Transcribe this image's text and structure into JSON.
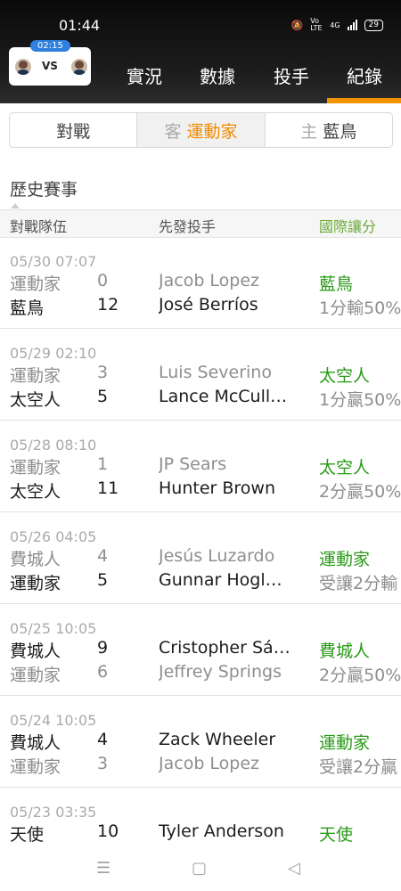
{
  "status": {
    "time": "01:44",
    "battery": "29",
    "network": "4G",
    "volte": "Vo LTE"
  },
  "scorecard": {
    "game_time": "02:15",
    "vs": "VS"
  },
  "nav": {
    "tabs": [
      "實況",
      "數據",
      "投手",
      "紀錄"
    ],
    "active": 3
  },
  "segment": {
    "tabs": [
      {
        "prefix": "",
        "label": "對戰",
        "active": false
      },
      {
        "prefix": "客",
        "label": "運動家",
        "active": true
      },
      {
        "prefix": "主",
        "label": "藍鳥",
        "active": false
      }
    ]
  },
  "section_title": "歷史賽事",
  "columns": {
    "teams": "對戰隊伍",
    "pitchers": "先發投手",
    "handicap": "國際讓分"
  },
  "games": [
    {
      "date": "05/30 07:07",
      "rows": [
        {
          "team": "運動家",
          "score": "0",
          "pitcher": "Jacob Lopez",
          "odds": "藍鳥",
          "win": false
        },
        {
          "team": "藍鳥",
          "score": "12",
          "pitcher": "José Berríos",
          "odds": "1分輸50%",
          "win": true
        }
      ]
    },
    {
      "date": "05/29 02:10",
      "rows": [
        {
          "team": "運動家",
          "score": "3",
          "pitcher": "Luis Severino",
          "odds": "太空人",
          "win": false
        },
        {
          "team": "太空人",
          "score": "5",
          "pitcher": "Lance McCullers Jr.",
          "odds": "1分贏50%",
          "win": true
        }
      ]
    },
    {
      "date": "05/28 08:10",
      "rows": [
        {
          "team": "運動家",
          "score": "1",
          "pitcher": "JP Sears",
          "odds": "太空人",
          "win": false
        },
        {
          "team": "太空人",
          "score": "11",
          "pitcher": "Hunter Brown",
          "odds": "2分贏50%",
          "win": true
        }
      ]
    },
    {
      "date": "05/26 04:05",
      "rows": [
        {
          "team": "費城人",
          "score": "4",
          "pitcher": "Jesús Luzardo",
          "odds": "運動家",
          "win": false
        },
        {
          "team": "運動家",
          "score": "5",
          "pitcher": "Gunnar Hoglund",
          "odds": "受讓2分輸",
          "win": true
        }
      ]
    },
    {
      "date": "05/25 10:05",
      "rows": [
        {
          "team": "費城人",
          "score": "9",
          "pitcher": "Cristopher Sánchez",
          "odds": "費城人",
          "win": true
        },
        {
          "team": "運動家",
          "score": "6",
          "pitcher": "Jeffrey Springs",
          "odds": "2分贏50%",
          "win": false
        }
      ]
    },
    {
      "date": "05/24 10:05",
      "rows": [
        {
          "team": "費城人",
          "score": "4",
          "pitcher": "Zack Wheeler",
          "odds": "運動家",
          "win": true
        },
        {
          "team": "運動家",
          "score": "3",
          "pitcher": "Jacob Lopez",
          "odds": "受讓2分贏",
          "win": false
        }
      ]
    },
    {
      "date": "05/23 03:35",
      "rows": [
        {
          "team": "天使",
          "score": "10",
          "pitcher": "Tyler Anderson",
          "odds": "天使",
          "win": true
        }
      ]
    }
  ],
  "bottom_nav": {
    "menu": "☰",
    "home": "▢",
    "back": "◁"
  }
}
